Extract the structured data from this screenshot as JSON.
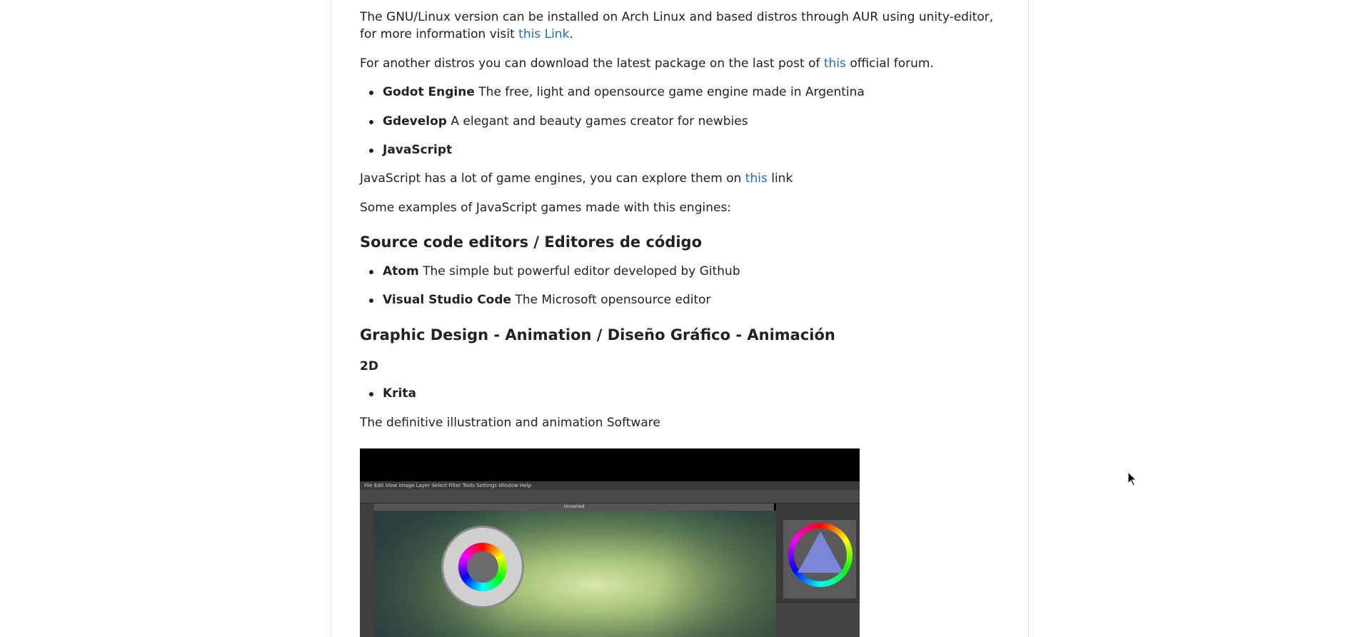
{
  "article": {
    "p_linux_text": "The GNU/Linux version can be installed on Arch Linux and based distros through AUR using unity-editor, for more information visit ",
    "p_linux_link": "this Link",
    "p_linux_end": ".",
    "p_distros_text": "For another distros you can download the latest package on the last post of ",
    "p_distros_link": "this",
    "p_distros_end": " official forum.",
    "engines": [
      {
        "name": "Godot Engine",
        "desc": " The free, light and opensource game engine made in Argentina"
      },
      {
        "name": "Gdevelop",
        "desc": " A elegant and beauty games creator for newbies"
      },
      {
        "name": "JavaScript",
        "desc": ""
      }
    ],
    "p_js_text": "JavaScript has a lot of game engines, you can explore them on ",
    "p_js_link": "this",
    "p_js_end": " link",
    "p_examples": "Some examples of JavaScript games made with this engines:",
    "h_editors": "Source code editors / Editores de código",
    "editors": [
      {
        "name": "Atom",
        "desc": " The simple but powerful editor developed by Github"
      },
      {
        "name": "Visual Studio Code",
        "desc": " The Microsoft opensource editor"
      }
    ],
    "h_graphics": "Graphic Design - Animation / Diseño Gráfico - Animación",
    "h_2d": "2D",
    "graphics": [
      {
        "name": "Krita",
        "desc": ""
      }
    ],
    "p_krita": "The definitive illustration and animation Software",
    "screenshot": {
      "alt": "Krita screenshot",
      "menu": "File  Edit  View  Image  Layer  Select  Filter  Tools  Settings  Window  Help",
      "tab_title": "Unnamed"
    }
  },
  "colors": {
    "link": "#1a6ec0",
    "text": "#222222",
    "border": "#dcdcdc"
  }
}
